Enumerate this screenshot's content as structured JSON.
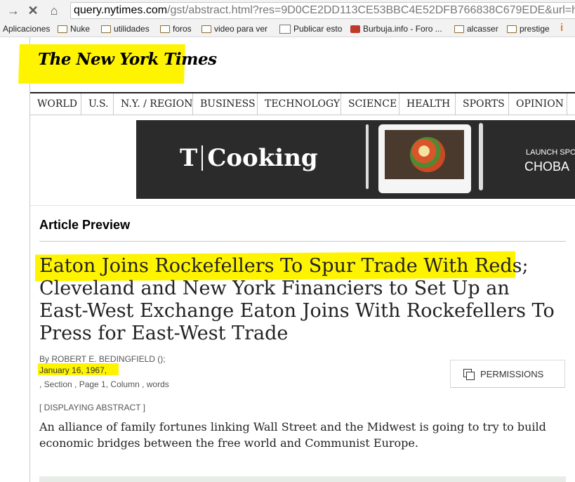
{
  "browser": {
    "url_host": "query.nytimes.com",
    "url_path": "/gst/abstract.html?res=9D0CE2DD113CE53BBC4E52DFB766838C679EDE&url=h",
    "bookmarks": [
      {
        "label": "Aplicaciones",
        "icon": "apps-grid-icon"
      },
      {
        "label": "Nuke",
        "icon": "folder-icon"
      },
      {
        "label": "utilidades",
        "icon": "folder-icon"
      },
      {
        "label": "foros",
        "icon": "folder-icon"
      },
      {
        "label": "video para ver",
        "icon": "folder-icon"
      },
      {
        "label": "Publicar esto",
        "icon": "page-icon"
      },
      {
        "label": "Burbuja.info - Foro ...",
        "icon": "burbuja-favicon-icon"
      },
      {
        "label": "alcasser",
        "icon": "folder-icon"
      },
      {
        "label": "prestige",
        "icon": "folder-icon"
      }
    ]
  },
  "site": {
    "logo_text": "The New York Times",
    "nav": [
      "WORLD",
      "U.S.",
      "N.Y. / REGION",
      "BUSINESS",
      "TECHNOLOGY",
      "SCIENCE",
      "HEALTH",
      "SPORTS",
      "OPINION"
    ]
  },
  "ad": {
    "brand": "Cooking",
    "launch_text": "LAUNCH SPON",
    "choba_text": "CHOBA"
  },
  "article": {
    "section_heading": "Article Preview",
    "headline": "Eaton Joins Rockefellers To Spur Trade With Reds; Cleveland and New York Financiers to Set Up an East-West Exchange Eaton Joins With Rockefellers To Press for East-West Trade",
    "byline": "By ROBERT E. BEDINGFIELD ();",
    "date": "January 16, 1967,",
    "section_info": ", Section , Page 1, Column , words",
    "permissions_label": "PERMISSIONS",
    "abstract_label": "[ DISPLAYING ABSTRACT ]",
    "abstract": "An alliance of family fortunes linking Wall Street and the Midwest is going to try to build economic bridges between the free world and Communist Europe."
  },
  "colors": {
    "highlight": "#fff400",
    "ad_background": "#2b2b2b"
  }
}
